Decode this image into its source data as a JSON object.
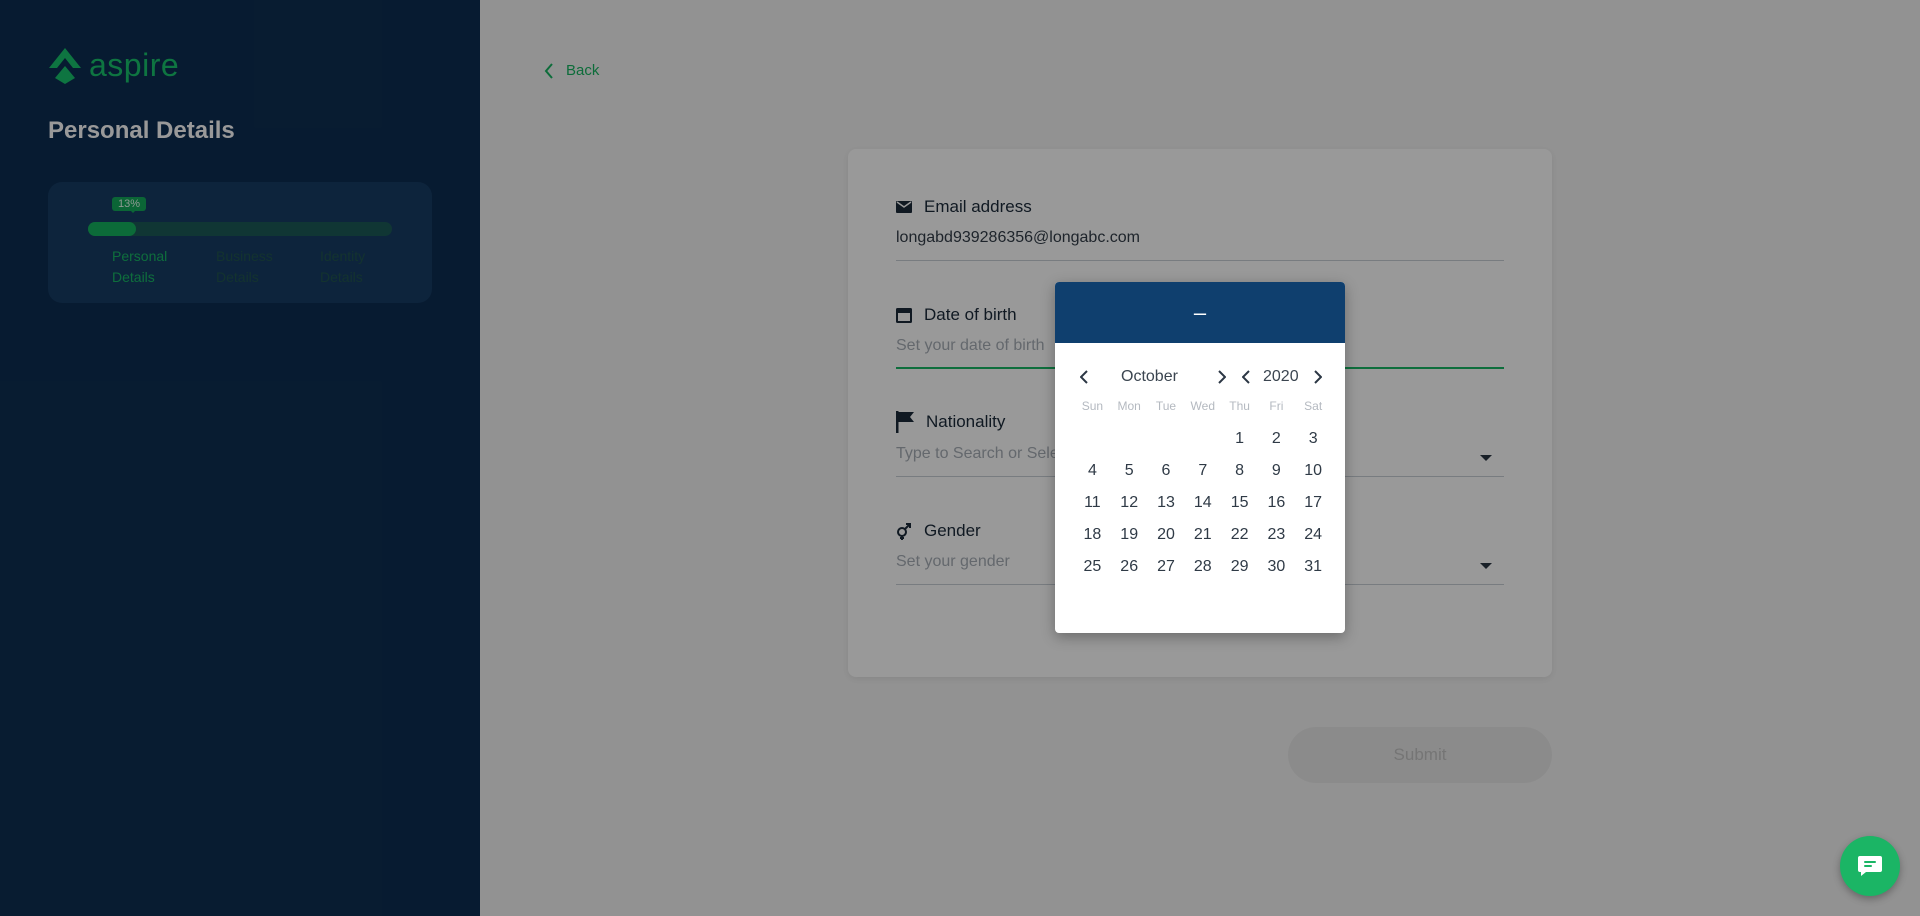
{
  "sidebar": {
    "logo_text": "aspire",
    "page_title": "Personal Details",
    "progress": {
      "percent_label": "13%",
      "percent": 13,
      "steps": [
        {
          "label": "Personal Details",
          "active": true
        },
        {
          "label": "Business Details",
          "active": false
        },
        {
          "label": "Identity Details",
          "active": false
        }
      ]
    }
  },
  "main": {
    "back_label": "Back",
    "fields": {
      "email": {
        "label": "Email address",
        "value": "longabd939286356@longabc.com"
      },
      "dob": {
        "label": "Date of birth",
        "placeholder": "Set your date of birth"
      },
      "nationality": {
        "label": "Nationality",
        "placeholder": "Type to Search or Select"
      },
      "gender": {
        "label": "Gender",
        "placeholder": "Set your gender"
      }
    },
    "submit_label": "Submit"
  },
  "datepicker": {
    "header_value": "–",
    "month": "October",
    "year": "2020",
    "weekdays": [
      "Sun",
      "Mon",
      "Tue",
      "Wed",
      "Thu",
      "Fri",
      "Sat"
    ],
    "first_weekday_index": 4,
    "days": [
      "1",
      "2",
      "3",
      "4",
      "5",
      "6",
      "7",
      "8",
      "9",
      "10",
      "11",
      "12",
      "13",
      "14",
      "15",
      "16",
      "17",
      "18",
      "19",
      "20",
      "21",
      "22",
      "23",
      "24",
      "25",
      "26",
      "27",
      "28",
      "29",
      "30",
      "31"
    ]
  },
  "colors": {
    "sidebar_bg": "#0d2e52",
    "accent_green": "#18b865",
    "datepicker_header": "#0f3f6e"
  },
  "icons": {
    "logo": "aspire-logo-icon",
    "back": "chevron-left-icon",
    "email": "envelope-icon",
    "dob": "calendar-icon",
    "nationality": "flag-icon",
    "gender": "gender-icon",
    "chat": "chat-bubble-icon"
  }
}
